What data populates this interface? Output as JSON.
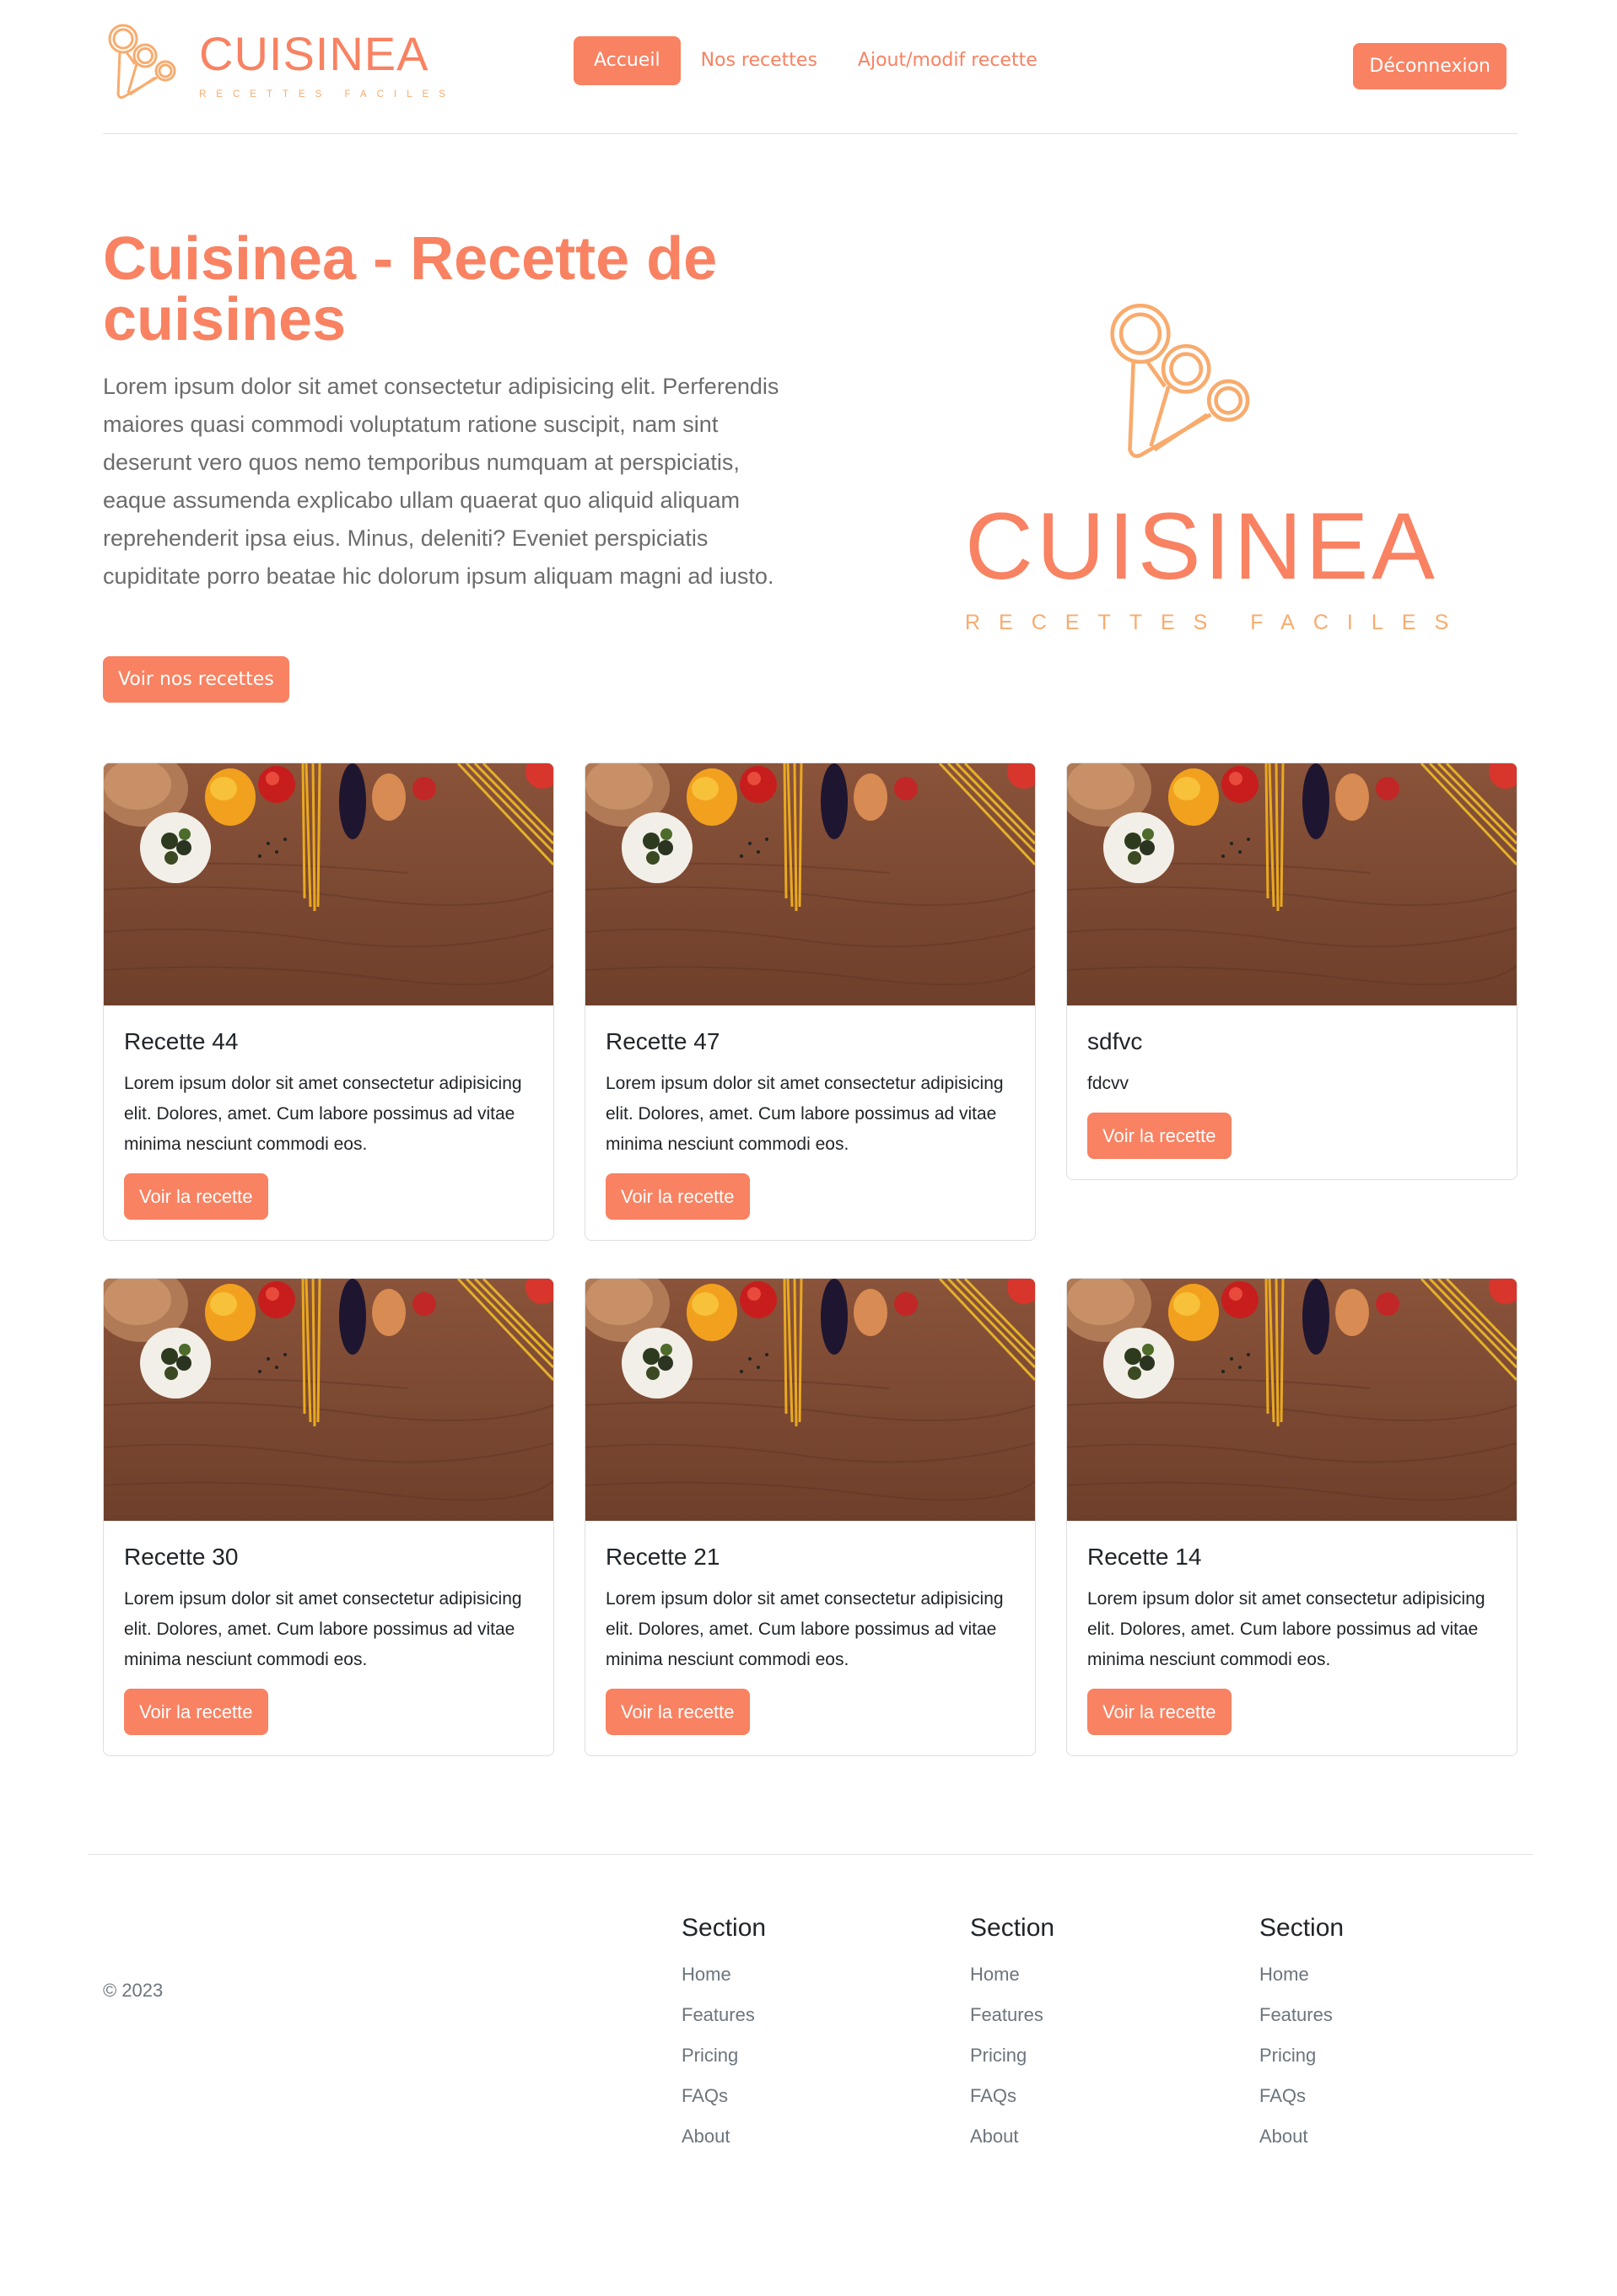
{
  "brand": {
    "name": "CUISINEA",
    "tagline": "RECETTES FACILES"
  },
  "colors": {
    "accent": "#f88262",
    "accent_light": "#f8ab6d",
    "text_muted": "#6c757d"
  },
  "nav": {
    "items": [
      {
        "label": "Accueil",
        "active": true
      },
      {
        "label": "Nos recettes",
        "active": false
      },
      {
        "label": "Ajout/modif recette",
        "active": false
      }
    ],
    "logout": "Déconnexion"
  },
  "hero": {
    "title": "Cuisinea - Recette de cuisines",
    "lead": "Lorem ipsum dolor sit amet consectetur adipisicing elit. Perferendis maiores quasi commodi voluptatum ratione suscipit, nam sint deserunt vero quos nemo temporibus numquam at perspiciatis, eaque assumenda explicabo ullam quaerat quo aliquid aliquam reprehenderit ipsa eius. Minus, deleniti? Eveniet perspiciatis cupiditate porro beatae hic dolorum ipsum aliquam magni ad iusto.",
    "cta": "Voir nos recettes"
  },
  "recipes": [
    {
      "title": "Recette 44",
      "text": "Lorem ipsum dolor sit amet consectetur adipisicing elit. Dolores, amet. Cum labore possimus ad vitae minima nesciunt commodi eos.",
      "button": "Voir la recette"
    },
    {
      "title": "Recette 47",
      "text": "Lorem ipsum dolor sit amet consectetur adipisicing elit. Dolores, amet. Cum labore possimus ad vitae minima nesciunt commodi eos.",
      "button": "Voir la recette"
    },
    {
      "title": "sdfvc",
      "text": "fdcvv",
      "button": "Voir la recette"
    },
    {
      "title": "Recette 30",
      "text": "Lorem ipsum dolor sit amet consectetur adipisicing elit. Dolores, amet. Cum labore possimus ad vitae minima nesciunt commodi eos.",
      "button": "Voir la recette"
    },
    {
      "title": "Recette 21",
      "text": "Lorem ipsum dolor sit amet consectetur adipisicing elit. Dolores, amet. Cum labore possimus ad vitae minima nesciunt commodi eos.",
      "button": "Voir la recette"
    },
    {
      "title": "Recette 14",
      "text": "Lorem ipsum dolor sit amet consectetur adipisicing elit. Dolores, amet. Cum labore possimus ad vitae minima nesciunt commodi eos.",
      "button": "Voir la recette"
    }
  ],
  "footer": {
    "copyright": "© 2023",
    "columns": [
      {
        "heading": "Section",
        "links": [
          "Home",
          "Features",
          "Pricing",
          "FAQs",
          "About"
        ]
      },
      {
        "heading": "Section",
        "links": [
          "Home",
          "Features",
          "Pricing",
          "FAQs",
          "About"
        ]
      },
      {
        "heading": "Section",
        "links": [
          "Home",
          "Features",
          "Pricing",
          "FAQs",
          "About"
        ]
      }
    ]
  }
}
